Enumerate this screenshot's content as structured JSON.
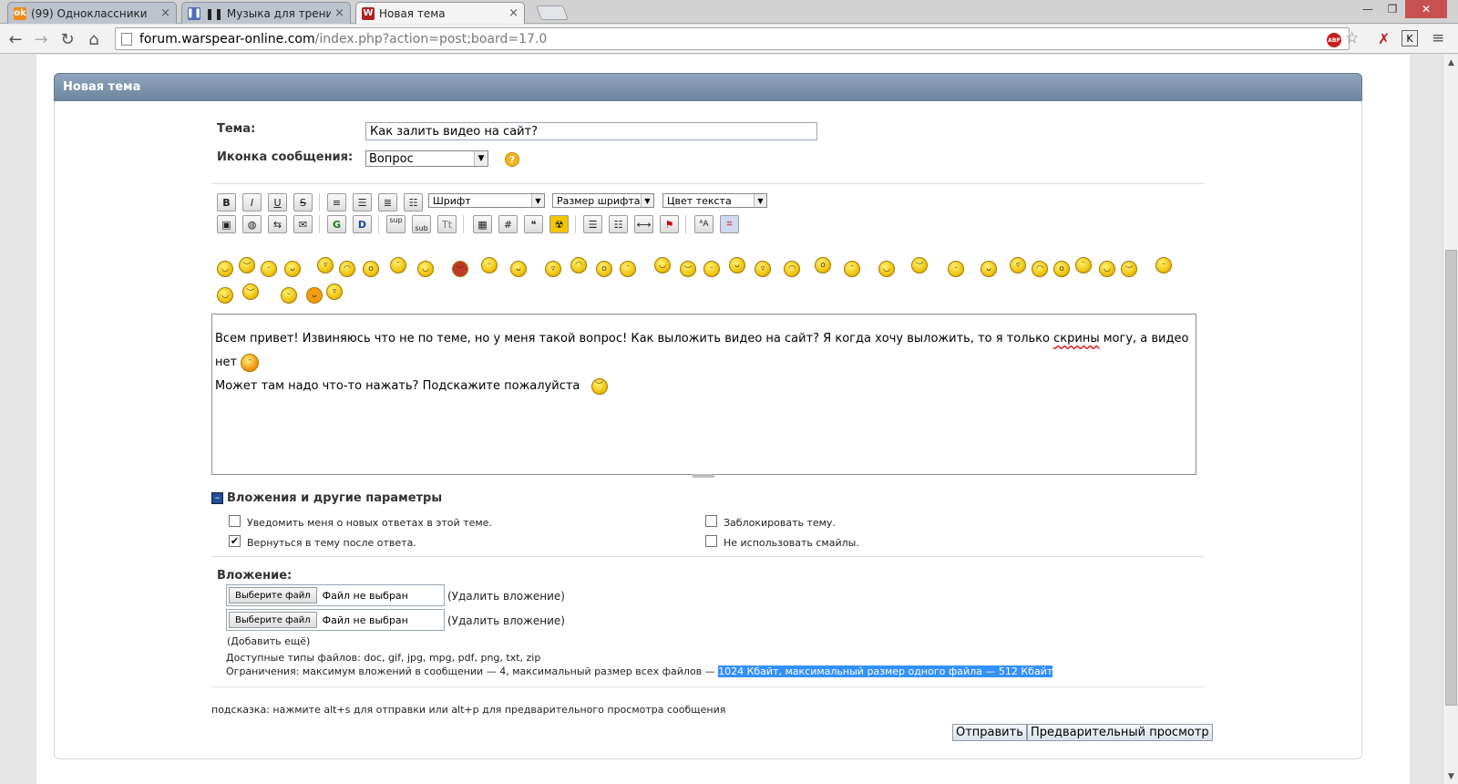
{
  "browser": {
    "tabs": [
      {
        "title": "(99) Одноклассники",
        "favicon": "odnoklassniki-icon",
        "color": "#f28a1a"
      },
      {
        "title": "❚❚ Музыка для трениров",
        "favicon": "pause-icon",
        "color": "#4b6cb7"
      },
      {
        "title": "Новая тема",
        "favicon": "warspear-icon",
        "color": "#b02020"
      }
    ],
    "url_host": "forum.warspear-online.com",
    "url_path": "/index.php?action=post;board=17.0",
    "abp_label": "ABP",
    "ext_k": "K"
  },
  "form": {
    "header": "Новая тема",
    "subject_label": "Тема:",
    "subject_value": "Как залить видео на сайт?",
    "icon_label": "Иконка сообщения:",
    "icon_value": "Вопрос",
    "help": "?",
    "font_select": "Шрифт",
    "size_select": "Размер шрифта",
    "color_select": "Цвет текста",
    "message_line1_a": "Всем привет! Извиняюсь что не по теме, но у меня такой вопрос! Как выложить видео на сайт? Я когда хочу выложить, то я только ",
    "message_line1_spell": "скрины",
    "message_line1_b": " могу, а видео нет",
    "message_line2": "Может там надо что-то нажать? Подскажите пожалуйста",
    "attachments_toggle": "Вложения и другие параметры",
    "opt_notify": "Уведомить меня о новых ответах в этой теме.",
    "opt_return": "Вернуться в тему после ответа.",
    "opt_lock": "Заблокировать тему.",
    "opt_nosmiley": "Не использовать смайлы.",
    "attach_label": "Вложение:",
    "file_button": "Выберите файл",
    "file_none": "Файл не выбран",
    "remove_attach": "(Удалить вложение)",
    "add_more": "(Добавить ещё)",
    "allowed_types": "Доступные типы файлов: doc, gif, jpg, mpg, pdf, png, txt, zip",
    "limits_a": "Ограничения: максимум вложений в сообщении — 4, максимальный размер всех файлов — ",
    "limits_b": "1024 Кбайт, максимальный размер одного файла — 512 Кбайт",
    "hint": "подсказка: нажмите alt+s для отправки или alt+p для предварительного просмотра сообщения",
    "submit": "Отправить",
    "preview": "Предварительный просмотр"
  },
  "toolbar_row1": [
    "B",
    "I",
    "U",
    "S"
  ],
  "colors": {
    "header_bar": "#7d92aa",
    "selection": "#3390ff"
  }
}
